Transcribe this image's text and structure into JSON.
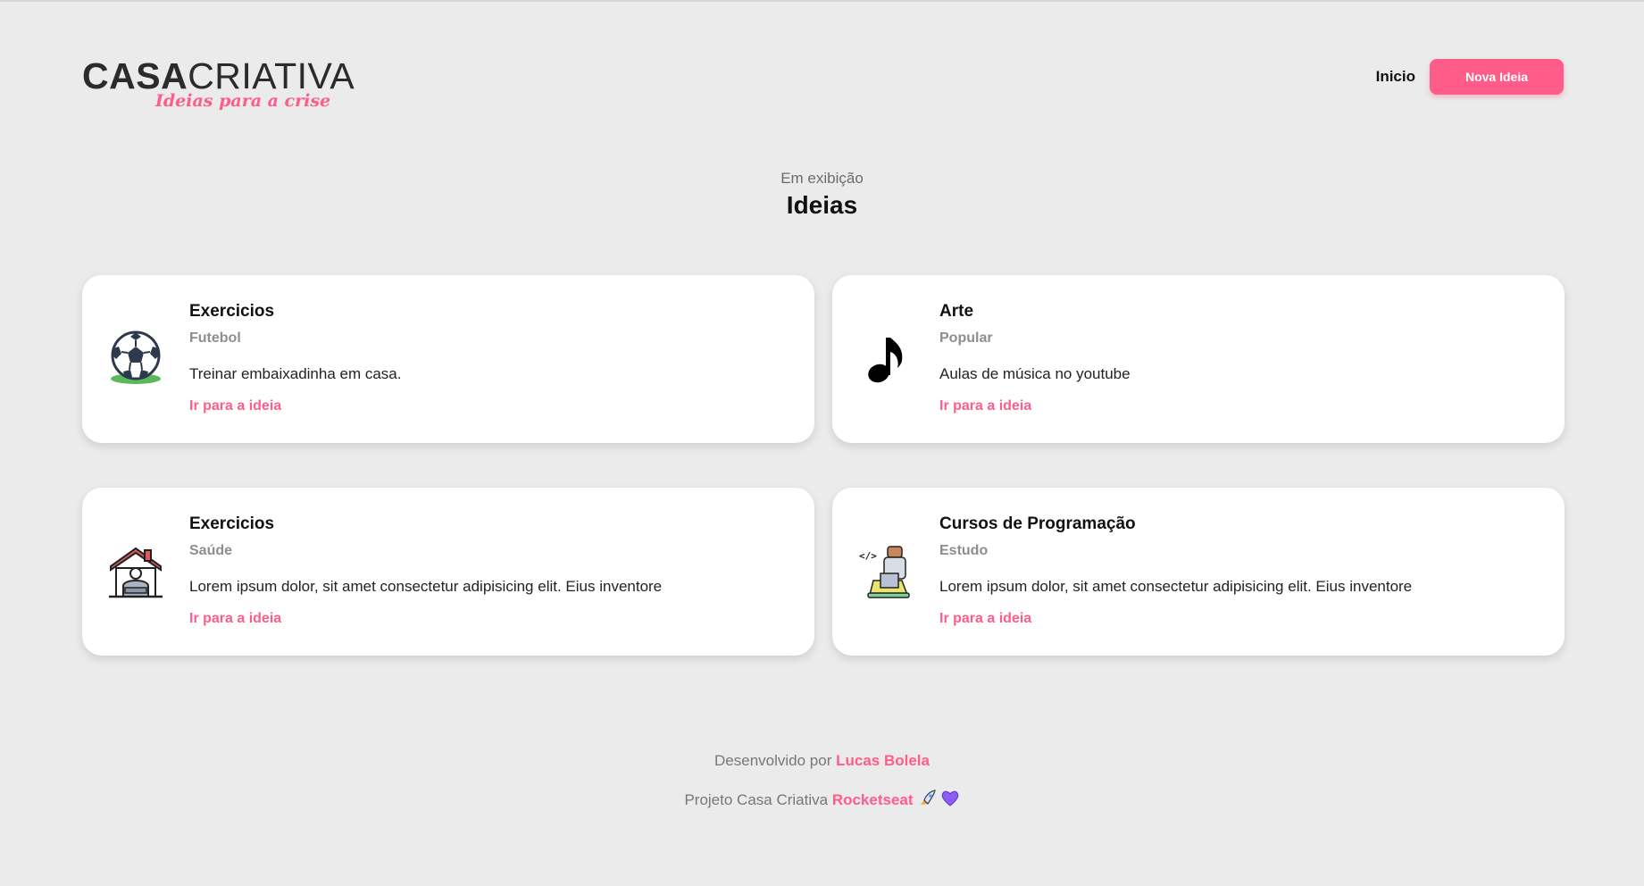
{
  "header": {
    "logo_bold": "CASA",
    "logo_light": "CRIATIVA",
    "logo_tagline": "Ideias para a crise",
    "nav_home": "Inicio",
    "nav_new_idea": "Nova Ideia"
  },
  "section": {
    "subtitle": "Em exibição",
    "title": "Ideias"
  },
  "ideas": [
    {
      "title": "Exercicios",
      "category": "Futebol",
      "description": "Treinar embaixadinha em casa.",
      "link": "Ir para a ideia",
      "icon": "soccer-ball-icon"
    },
    {
      "title": "Arte",
      "category": "Popular",
      "description": "Aulas de música no youtube",
      "link": "Ir para a ideia",
      "icon": "music-note-icon"
    },
    {
      "title": "Exercicios",
      "category": "Saúde",
      "description": "Lorem ipsum dolor, sit amet consectetur adipisicing elit. Eius inventore",
      "link": "Ir para a ideia",
      "icon": "home-workout-icon"
    },
    {
      "title": "Cursos de Programação",
      "category": "Estudo",
      "description": "Lorem ipsum dolor, sit amet consectetur adipisicing elit. Eius inventore",
      "link": "Ir para a ideia",
      "icon": "programmer-icon"
    }
  ],
  "footer": {
    "dev_prefix": "Desenvolvido por",
    "dev_name": "Lucas Bolela",
    "project_prefix": "Projeto Casa Criativa",
    "project_brand": "Rocketseat",
    "emoji_icons": [
      "rocket-icon",
      "purple-heart-icon"
    ]
  },
  "colors": {
    "accent": "#ff5c8a",
    "background": "#ebebeb",
    "card": "#ffffff"
  }
}
